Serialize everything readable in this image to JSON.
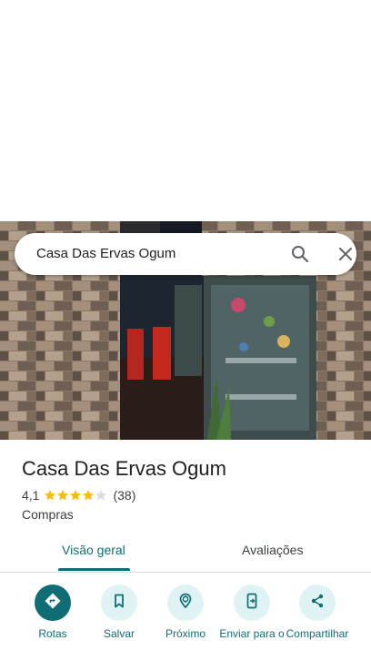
{
  "search": {
    "query": "Casa Das Ervas Ogum"
  },
  "place": {
    "name": "Casa Das Ervas Ogum",
    "rating": "4,1",
    "stars": 4.1,
    "review_count": "(38)",
    "category": "Compras"
  },
  "tabs": [
    {
      "label": "Visão geral",
      "active": true
    },
    {
      "label": "Avaliações",
      "active": false
    }
  ],
  "actions": [
    {
      "label": "Rotas",
      "icon": "directions-icon"
    },
    {
      "label": "Salvar",
      "icon": "bookmark-icon"
    },
    {
      "label": "Próximo",
      "icon": "nearby-icon"
    },
    {
      "label": "Enviar para o",
      "icon": "send-to-phone-icon"
    },
    {
      "label": "Compartilhar",
      "icon": "share-icon"
    }
  ],
  "colors": {
    "accent": "#0f6e73",
    "star": "#fbbc04",
    "action_bg": "#e0f3f4"
  }
}
